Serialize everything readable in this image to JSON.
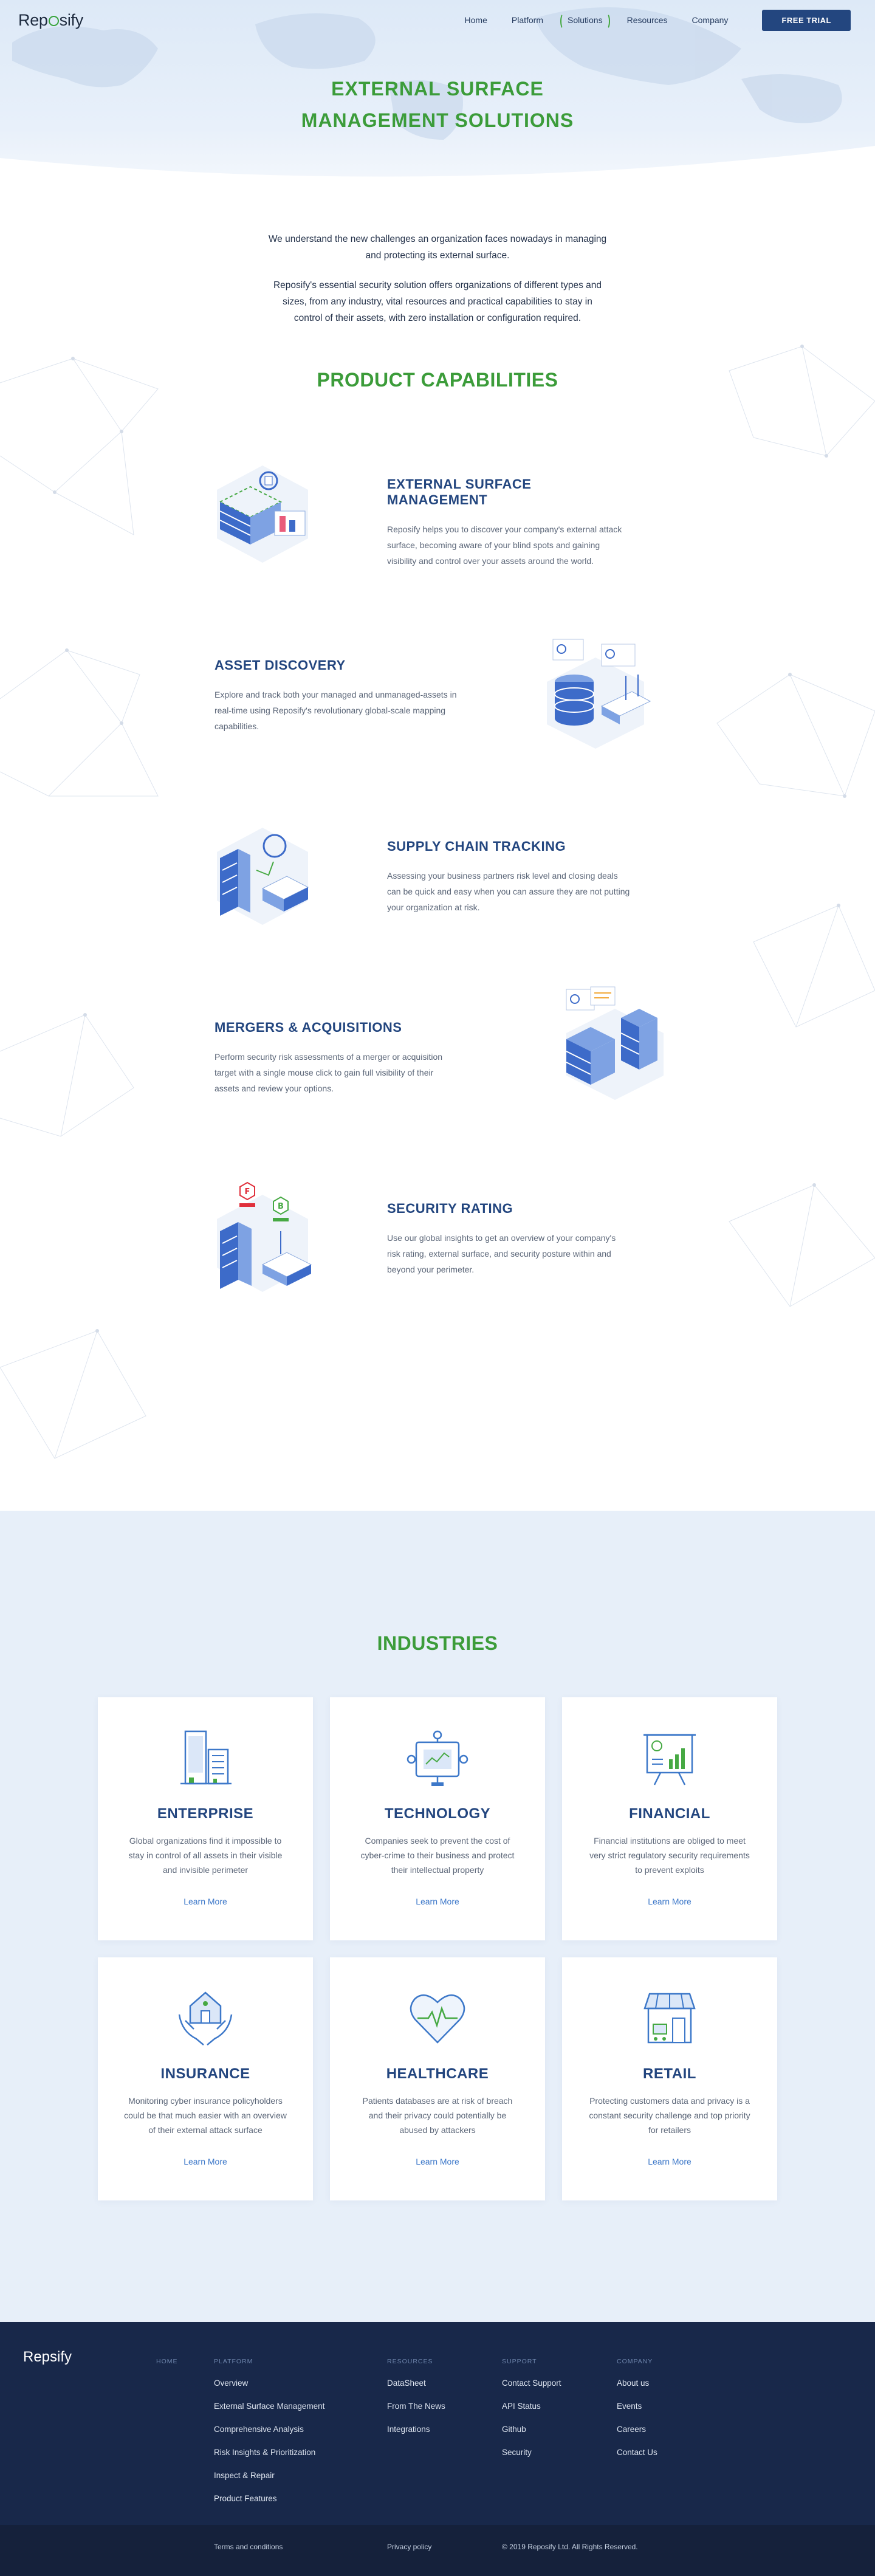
{
  "nav": {
    "logo": "Reposify",
    "links": [
      {
        "label": "Home"
      },
      {
        "label": "Platform"
      },
      {
        "label": "Solutions"
      },
      {
        "label": "Resources"
      },
      {
        "label": "Company"
      }
    ],
    "cta": "FREE TRIAL"
  },
  "hero": {
    "title_line1": "EXTERNAL SURFACE",
    "title_line2": "MANAGEMENT SOLUTIONS"
  },
  "intro": {
    "p1": "We understand the new challenges an organization faces nowadays in managing and protecting its external surface.",
    "p2": "Reposify's essential security solution offers organizations of different types and sizes, from any industry, vital resources and practical capabilities to stay in control of their assets, with zero installation or configuration required."
  },
  "capabilities": {
    "title": "PRODUCT CAPABILITIES",
    "items": [
      {
        "title": "EXTERNAL SURFACE MANAGEMENT",
        "desc": "Reposify helps you to discover your company's external attack surface, becoming aware of your blind spots and gaining visibility and control over your assets around the world."
      },
      {
        "title": "ASSET DISCOVERY",
        "desc": "Explore and track both your managed and unmanaged-assets in real-time using Reposify's revolutionary global-scale mapping capabilities."
      },
      {
        "title": "SUPPLY CHAIN TRACKING",
        "desc": "Assessing your business partners risk level and closing deals can be quick and easy when you can assure they are not putting your organization at risk."
      },
      {
        "title": "MERGERS & ACQUISITIONS",
        "desc": "Perform security risk assessments of a merger or acquisition target with a single mouse click to gain full visibility of their assets and review your options."
      },
      {
        "title": "SECURITY RATING",
        "desc": "Use our global insights to get an overview of your company's risk rating, external surface, and security posture within and beyond your perimeter."
      }
    ],
    "rating_badges": [
      "F",
      "B"
    ]
  },
  "industries": {
    "title": "INDUSTRIES",
    "items": [
      {
        "title": "ENTERPRISE",
        "desc": "Global organizations find it impossible to stay in control of all assets in their visible and invisible perimeter",
        "link": "Learn More",
        "icon": "buildings-icon"
      },
      {
        "title": "TECHNOLOGY",
        "desc": "Companies seek to prevent the cost of cyber-crime to their business and protect their intellectual property",
        "link": "Learn More",
        "icon": "chip-icon"
      },
      {
        "title": "FINANCIAL",
        "desc": "Financial institutions are obliged to meet very strict regulatory security requirements to prevent exploits",
        "link": "Learn More",
        "icon": "finance-board-icon"
      },
      {
        "title": "INSURANCE",
        "desc": "Monitoring cyber insurance policyholders could be that much easier with an overview of their external attack surface",
        "link": "Learn More",
        "icon": "house-hands-icon"
      },
      {
        "title": "HEALTHCARE",
        "desc": "Patients databases are at risk of breach and their privacy could potentially be abused by attackers",
        "link": "Learn More",
        "icon": "heart-pulse-icon"
      },
      {
        "title": "RETAIL",
        "desc": "Protecting customers data and privacy is a constant security challenge and top priority for retailers",
        "link": "Learn More",
        "icon": "storefront-icon"
      }
    ]
  },
  "footer": {
    "logo": "Reposify",
    "home": "HOME",
    "platform": {
      "head": "PLATFORM",
      "items": [
        "Overview",
        "External Surface Management",
        "Comprehensive Analysis",
        "Risk Insights & Prioritization",
        "Inspect & Repair",
        "Product Features"
      ]
    },
    "resources": {
      "head": "RESOURCES",
      "items": [
        "DataSheet",
        "From The News",
        "Integrations"
      ]
    },
    "support": {
      "head": "SUPPORT",
      "items": [
        "Contact Support",
        "API Status",
        "Github",
        "Security"
      ]
    },
    "company": {
      "head": "COMPANY",
      "items": [
        "About us",
        "Events",
        "Careers",
        "Contact Us"
      ]
    },
    "terms": "Terms and conditions",
    "privacy": "Privacy policy",
    "copyright": "© 2019 Reposify Ltd. All Rights Reserved."
  },
  "colors": {
    "green": "#3c9c3a",
    "navy": "#23467f",
    "link_blue": "#3d78c9",
    "footer_bg": "#18284a",
    "industries_bg": "#e7eff9"
  }
}
